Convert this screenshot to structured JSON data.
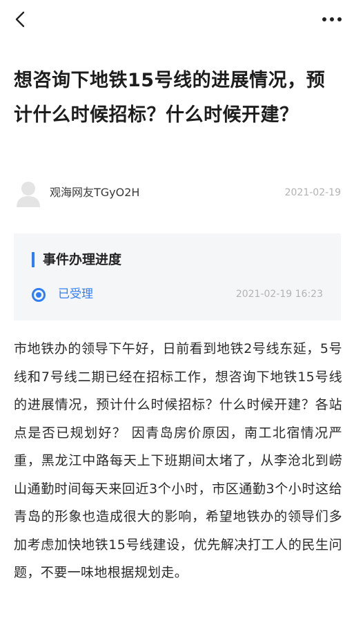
{
  "nav": {
    "back_icon": "chevron-left-icon",
    "more_icon": "more-horizontal-icon"
  },
  "article": {
    "title": "想咨询下地铁15号线的进展情况，预计什么时候招标？什么时候开建？",
    "author": "观海网友TGyO2H",
    "date": "2021-02-19",
    "avatar_icon": "user-avatar-icon"
  },
  "progress": {
    "heading": "事件办理进度",
    "status": "已受理",
    "status_time": "2021-02-19 16:23",
    "accent_color": "#2f7ef7"
  },
  "content": {
    "text": "市地铁办的领导下午好，日前看到地铁2号线东延，5号线和7号线二期已经在招标工作，想咨询下地铁15号线的进展情况，预计什么时候招标？什么时候开建？各站点是否已规划好？ 因青岛房价原因，南工北宿情况严重，黑龙江中路每天上下班期间太堵了，从李沧北到崂山通勤时间每天来回近3个小时，市区通勤3个小时这给青岛的形象也造成很大的影响，希望地铁办的领导们多加考虑加快地铁15号线建设，优先解决打工人的民生问题，不要一味地根据规划走。"
  }
}
